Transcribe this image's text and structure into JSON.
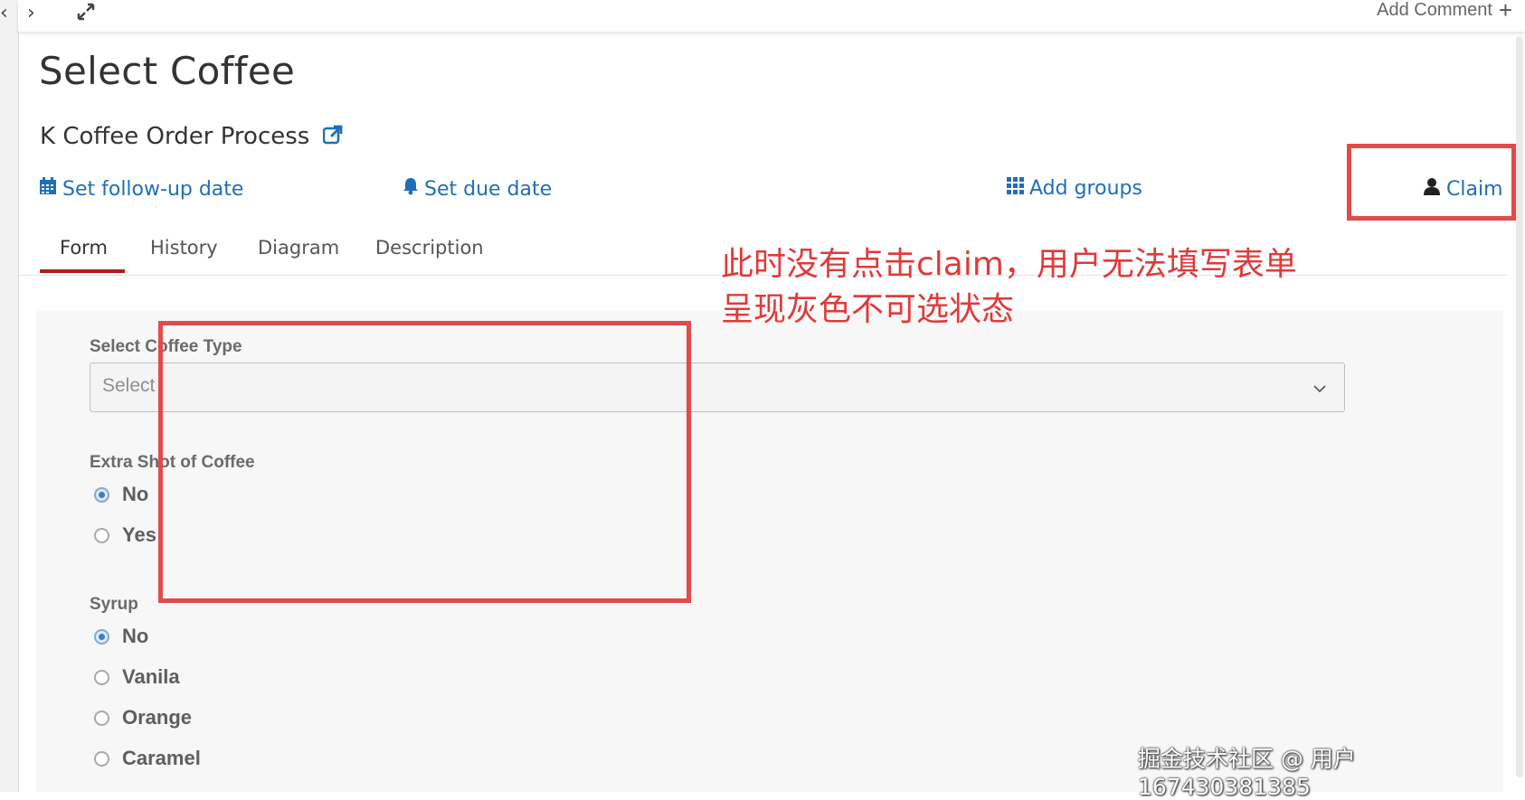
{
  "topbar": {
    "add_comment_label": "Add Comment",
    "plus_symbol": "+"
  },
  "task": {
    "title": "Select Coffee",
    "process_name": "K Coffee Order Process"
  },
  "actions": {
    "followup_label": "Set follow-up date",
    "due_label": "Set due date",
    "groups_label": "Add groups",
    "claim_label": "Claim"
  },
  "tabs": [
    {
      "label": "Form",
      "active": true
    },
    {
      "label": "History",
      "active": false
    },
    {
      "label": "Diagram",
      "active": false
    },
    {
      "label": "Description",
      "active": false
    }
  ],
  "form": {
    "coffee_type": {
      "label": "Select Coffee Type",
      "placeholder": "Select"
    },
    "extra_shot": {
      "label": "Extra Shot of Coffee",
      "options": [
        {
          "label": "No",
          "checked": true
        },
        {
          "label": "Yes",
          "checked": false
        }
      ]
    },
    "syrup": {
      "label": "Syrup",
      "options": [
        {
          "label": "No",
          "checked": true
        },
        {
          "label": "Vanila",
          "checked": false
        },
        {
          "label": "Orange",
          "checked": false
        },
        {
          "label": "Caramel",
          "checked": false
        }
      ]
    }
  },
  "annotation": {
    "line1": "此时没有点击claim，用户无法填写表单",
    "line2": "呈现灰色不可选状态"
  },
  "watermark": "掘金技术社区 @ 用户167430381385",
  "colors": {
    "link": "#1f6fb6",
    "tab_active": "#b31b1b",
    "highlight": "#e24b4b",
    "radio_checked": "#3b7fc4"
  }
}
